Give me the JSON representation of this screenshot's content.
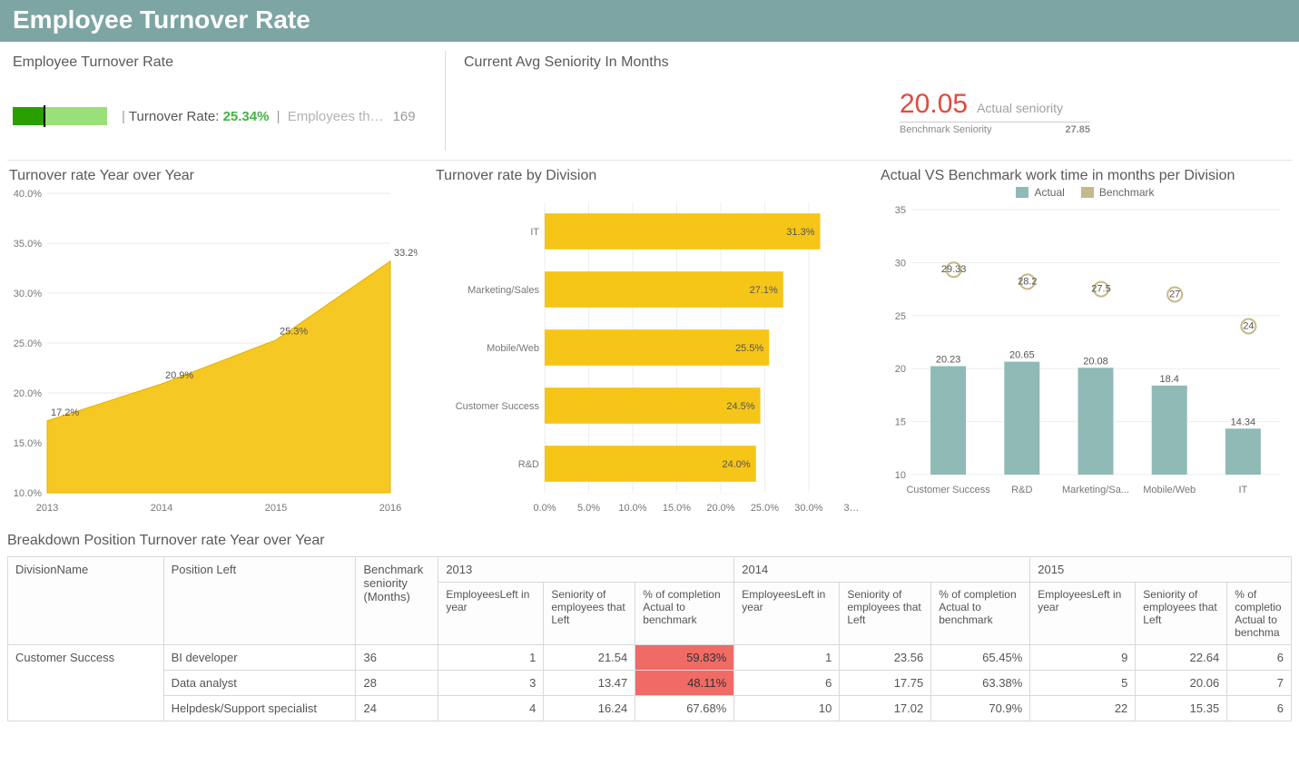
{
  "header": {
    "title": "Employee Turnover Rate"
  },
  "kpi_turnover": {
    "title": "Employee Turnover Rate",
    "label": "Turnover Rate:",
    "value": "25.34%",
    "emp_label": "Employees th…",
    "emp_value": "169"
  },
  "kpi_seniority": {
    "title": "Current Avg Seniority In Months",
    "value": "20.05",
    "label": "Actual seniority",
    "bench_label": "Benchmark Seniority",
    "bench_value": "27.85"
  },
  "area": {
    "title": "Turnover rate Year over Year"
  },
  "hbar": {
    "title": "Turnover rate by Division"
  },
  "cols": {
    "title": "Actual VS Benchmark work time in months per Division",
    "legend_actual": "Actual",
    "legend_bench": "Benchmark"
  },
  "table": {
    "title": "Breakdown Position Turnover rate Year over Year",
    "headers": {
      "division": "DivisionName",
      "position": "Position Left",
      "bench": "Benchmark seniority (Months)",
      "y2013": "2013",
      "y2014": "2014",
      "y2015": "2015",
      "sub_emp": "EmployeesLeft in year",
      "sub_sen": "Seniority of employees that Left",
      "sub_pct": "% of completion Actual to benchmark",
      "sub_pct_cut": "% of completio Actual to benchma"
    },
    "division_label": "Customer Success",
    "rows": [
      {
        "pos": "BI developer",
        "bench": "36",
        "a": "1",
        "b": "21.54",
        "c": "59.83%",
        "c_bad": true,
        "d": "1",
        "e": "23.56",
        "f": "65.45%",
        "g": "9",
        "h": "22.64",
        "i": "6"
      },
      {
        "pos": "Data analyst",
        "bench": "28",
        "a": "3",
        "b": "13.47",
        "c": "48.11%",
        "c_bad": true,
        "d": "6",
        "e": "17.75",
        "f": "63.38%",
        "g": "5",
        "h": "20.06",
        "i": "7"
      },
      {
        "pos": "Helpdesk/Support specialist",
        "bench": "24",
        "a": "4",
        "b": "16.24",
        "c": "67.68%",
        "d": "10",
        "e": "17.02",
        "f": "70.9%",
        "g": "22",
        "h": "15.35",
        "i": "6"
      }
    ]
  },
  "chart_data": [
    {
      "id": "turnover_yoy",
      "type": "area",
      "title": "Turnover rate Year over Year",
      "x": [
        2013,
        2014,
        2015,
        2016
      ],
      "values": [
        17.2,
        20.9,
        25.3,
        33.2
      ],
      "ylabel": "%",
      "ylim": [
        10,
        40
      ],
      "yticks": [
        10,
        15,
        20,
        25,
        30,
        35,
        40
      ],
      "value_suffix": "%",
      "color": "#f5c518"
    },
    {
      "id": "turnover_by_division",
      "type": "bar",
      "orientation": "horizontal",
      "title": "Turnover rate by Division",
      "categories": [
        "IT",
        "Marketing/Sales",
        "Mobile/Web",
        "Customer Success",
        "R&D"
      ],
      "values": [
        31.3,
        27.1,
        25.5,
        24.5,
        24.0
      ],
      "value_suffix": "%",
      "xlim": [
        0,
        33
      ],
      "xticks": [
        0,
        5,
        10,
        15,
        20,
        25,
        30
      ],
      "color": "#f5c518"
    },
    {
      "id": "actual_vs_benchmark",
      "type": "bar",
      "orientation": "vertical",
      "title": "Actual VS Benchmark work time in months per Division",
      "categories": [
        "Customer Success",
        "R&D",
        "Marketing/Sa...",
        "Mobile/Web",
        "IT"
      ],
      "series": [
        {
          "name": "Actual",
          "color": "#8fbab6",
          "values": [
            20.23,
            20.65,
            20.08,
            18.4,
            14.34
          ]
        },
        {
          "name": "Benchmark",
          "color": "#c7b887",
          "values": [
            29.33,
            28.2,
            27.5,
            27,
            24
          ],
          "display_labels": [
            "29.33",
            "28.2",
            "27.5",
            "27",
            "24"
          ],
          "render_as": "marker"
        }
      ],
      "ylim": [
        10,
        35
      ],
      "yticks": [
        10,
        15,
        20,
        25,
        30,
        35
      ]
    }
  ]
}
